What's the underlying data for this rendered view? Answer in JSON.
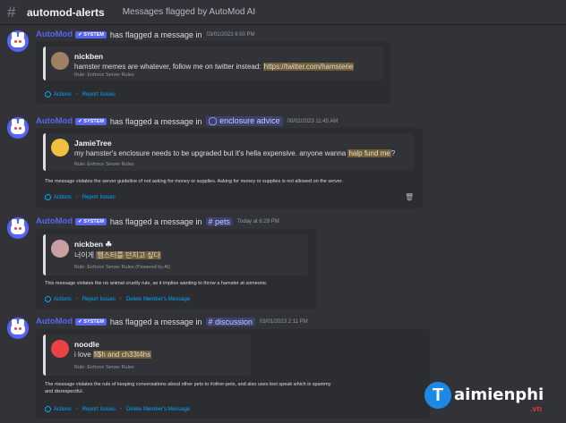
{
  "channel": {
    "name": "automod-alerts",
    "topic": "Messages flagged by AutoMod AI"
  },
  "bot": {
    "name": "AutoMod",
    "tag": "✔ SYSTEM",
    "action_text": "has flagged a message in"
  },
  "messages": [
    {
      "channel_ref": "",
      "time": "03/01/2023 6:50 PM",
      "user": "nickben",
      "text_pre": "hamster memes are whatever, follow me on twitter instead: ",
      "text_hl": "https://twitter.com/hamsterie",
      "text_post": "",
      "rule": "Rule: Enforce Server Rules",
      "reason": [],
      "actions": [
        "Actions",
        "Report Issues"
      ]
    },
    {
      "channel_ref": "◯ enclosure advice",
      "time": "00/02/2023 11:45 AM",
      "user": "JamieTree",
      "text_pre": "my hamster's enclosure needs to be upgraded but it's hella expensive. anyone wanna ",
      "text_hl": "halp fund me",
      "text_post": "?",
      "rule": "Rule: Enforce Server Rules",
      "reason": [
        "The message violates the server guideline of not asking for money or supplies. Asking for money or supplies is not allowed on the server."
      ],
      "actions": [
        "Actions",
        "Report Issues"
      ]
    },
    {
      "channel_ref": "# pets",
      "time": "Today at 6:29 PM",
      "user": "nickben ☘",
      "text_pre": "너이게 ",
      "text_hl": "햄스터를 던지고 싶다",
      "text_post": "",
      "rule": "Rule: Enforce Server Rules (Powered by AI)",
      "reason": [
        "This message violates the no animal cruelty rule, as it implies wanting to throw a hamster at someone."
      ],
      "actions": [
        "Actions",
        "Report Issues",
        "Delete Member's Message"
      ]
    },
    {
      "channel_ref": "# discussion",
      "time": "03/01/2023 2:11 PM",
      "user": "noodle",
      "text_pre": "i love ",
      "text_hl": "fi$h and ch33t4hs",
      "text_post": "",
      "rule": "Rule: Enforce Server Rules",
      "reason": [
        "The message violates the rule of keeping conversations about other pets to #other-pets, and also uses leet speak which is spammy",
        "and disrespectful."
      ],
      "actions": [
        "Actions",
        "Report Issues",
        "Delete Member's Message"
      ]
    }
  ],
  "watermark": {
    "initial": "T",
    "brand": "aimienphi",
    "tld": ".vn"
  }
}
